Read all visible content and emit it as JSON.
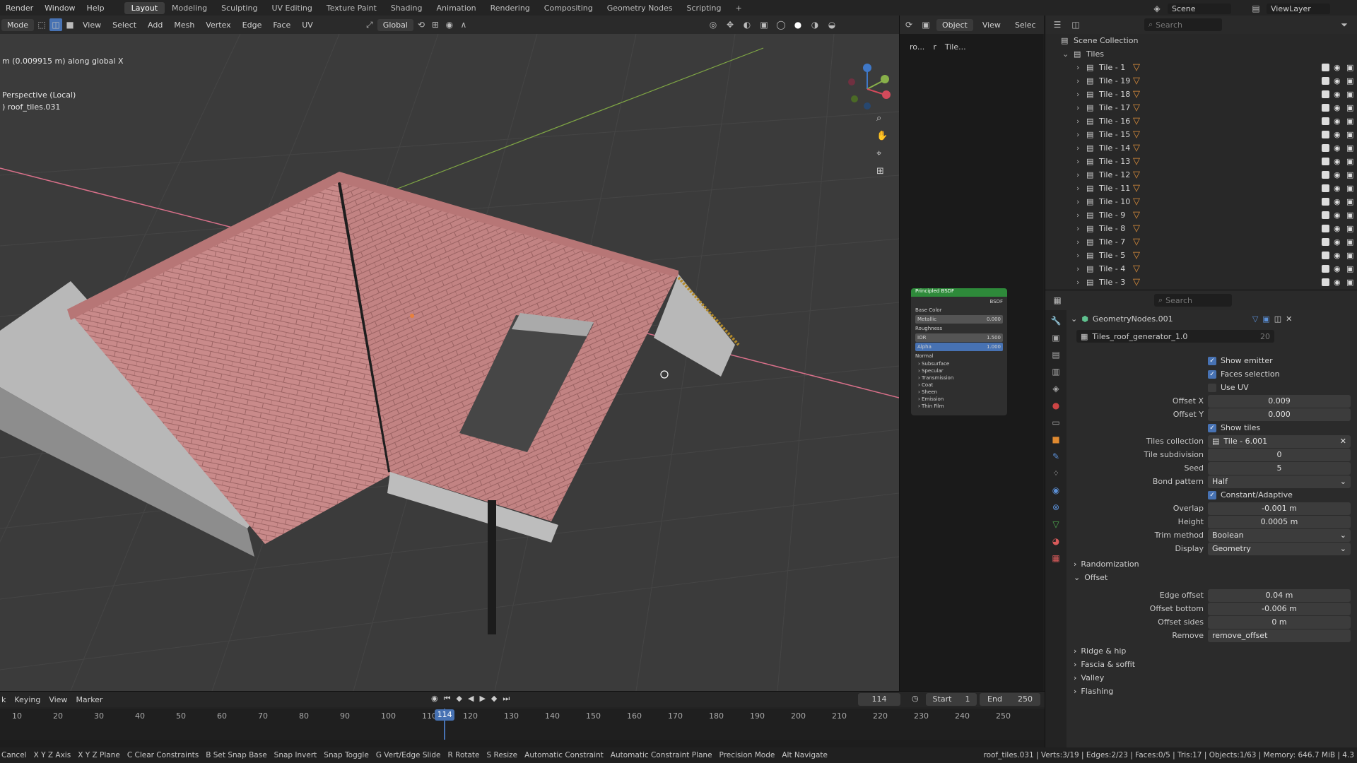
{
  "topbar": {
    "menus": [
      "Render",
      "Window",
      "Help"
    ],
    "workspaces": [
      "Layout",
      "Modeling",
      "Sculpting",
      "UV Editing",
      "Texture Paint",
      "Shading",
      "Animation",
      "Rendering",
      "Compositing",
      "Geometry Nodes",
      "Scripting"
    ],
    "active_workspace": "Layout",
    "add_tab": "+",
    "scene_label": "Scene",
    "viewlayer_label": "ViewLayer"
  },
  "header": {
    "mode": "Mode",
    "menus": [
      "View",
      "Select",
      "Add",
      "Mesh",
      "Vertex",
      "Edge",
      "Face",
      "UV"
    ],
    "transform_orientation": "Global",
    "object_mode": "Object",
    "right_menus": [
      "View",
      "Selec"
    ]
  },
  "viewport": {
    "operator_info": "m (0.009915 m) along global X",
    "view_name": "Perspective (Local)",
    "object_name": ") roof_tiles.031",
    "colors": {
      "tile": "#c98a8a",
      "grid": "#444444",
      "x_axis": "#d9708a",
      "y_axis": "#7fa644"
    }
  },
  "node_editor": {
    "breadcrumb": [
      "ro...",
      "r",
      "Tile..."
    ],
    "node_title": "Principled BSDF",
    "output": "BSDF",
    "inputs": [
      {
        "label": "Base Color",
        "value": ""
      },
      {
        "label": "Metallic",
        "value": "0.000"
      },
      {
        "label": "Roughness",
        "value": ""
      },
      {
        "label": "IOR",
        "value": "1.500"
      },
      {
        "label": "Alpha",
        "value": "1.000"
      },
      {
        "label": "Normal",
        "value": ""
      }
    ],
    "panels": [
      "Subsurface",
      "Specular",
      "Transmission",
      "Coat",
      "Sheen",
      "Emission",
      "Thin Film"
    ]
  },
  "outliner": {
    "search_placeholder": "Search",
    "root": "Scene Collection",
    "collection": "Tiles",
    "items": [
      "Tile - 1",
      "Tile - 19",
      "Tile - 18",
      "Tile - 17",
      "Tile - 16",
      "Tile - 15",
      "Tile - 14",
      "Tile - 13",
      "Tile - 12",
      "Tile - 11",
      "Tile - 10",
      "Tile - 9",
      "Tile - 8",
      "Tile - 7",
      "Tile - 5",
      "Tile - 4",
      "Tile - 3"
    ]
  },
  "properties": {
    "search_placeholder": "Search",
    "modifier_name": "GeometryNodes.001",
    "node_group": "Tiles_roof_generator_1.0",
    "users": "20",
    "fields": [
      {
        "type": "check",
        "label": "Show emitter",
        "checked": true
      },
      {
        "type": "check",
        "label": "Faces selection",
        "checked": true
      },
      {
        "type": "check",
        "label": "Use UV",
        "checked": false
      },
      {
        "type": "value",
        "label": "Offset X",
        "value": "0.009"
      },
      {
        "type": "value",
        "label": "Offset Y",
        "value": "0.000"
      },
      {
        "type": "check",
        "label": "Show tiles",
        "checked": true
      },
      {
        "type": "object",
        "label": "Tiles collection",
        "value": "Tile - 6.001"
      },
      {
        "type": "value",
        "label": "Tile subdivision",
        "value": "0"
      },
      {
        "type": "value",
        "label": "Seed",
        "value": "5"
      },
      {
        "type": "enum",
        "label": "Bond pattern",
        "value": "Half"
      },
      {
        "type": "check",
        "label": "Constant/Adaptive",
        "checked": true
      },
      {
        "type": "value",
        "label": "Overlap",
        "value": "-0.001 m"
      },
      {
        "type": "value",
        "label": "Height",
        "value": "0.0005 m"
      },
      {
        "type": "enum",
        "label": "Trim method",
        "value": "Boolean"
      },
      {
        "type": "enum",
        "label": "Display",
        "value": "Geometry"
      }
    ],
    "sections": [
      {
        "label": "Randomization",
        "open": false
      },
      {
        "label": "Offset",
        "open": true
      }
    ],
    "offset_fields": [
      {
        "label": "Edge offset",
        "value": "0.04 m"
      },
      {
        "label": "Offset bottom",
        "value": "-0.006 m"
      },
      {
        "label": "Offset sides",
        "value": "0 m"
      },
      {
        "label": "Remove",
        "value": "remove_offset"
      }
    ],
    "more_sections": [
      "Ridge & hip",
      "Fascia & soffit",
      "Valley",
      "Flashing"
    ]
  },
  "timeline": {
    "menus": [
      "k",
      "Keying",
      "View",
      "Marker"
    ],
    "current_frame": "114",
    "start_label": "Start",
    "start": "1",
    "end_label": "End",
    "end": "250",
    "ticks": [
      "10",
      "20",
      "30",
      "40",
      "50",
      "60",
      "70",
      "80",
      "90",
      "100",
      "110",
      "120",
      "130",
      "140",
      "150",
      "160",
      "170",
      "180",
      "190",
      "200",
      "210",
      "220",
      "230",
      "240",
      "250"
    ]
  },
  "statusbar": {
    "hints": [
      "Cancel",
      "X Y Z Axis",
      "X Y Z Plane",
      "C Clear Constraints",
      "B Set Snap Base",
      "Snap Invert",
      "Snap Toggle",
      "G Vert/Edge Slide",
      "R Rotate",
      "S Resize",
      "Automatic Constraint",
      "Automatic Constraint Plane",
      "Precision Mode",
      "Alt Navigate"
    ],
    "stats": "roof_tiles.031 | Verts:3/19 | Edges:2/23 | Faces:0/5 | Tris:17 | Objects:1/63 | Memory: 646.7 MiB | 4.3"
  }
}
